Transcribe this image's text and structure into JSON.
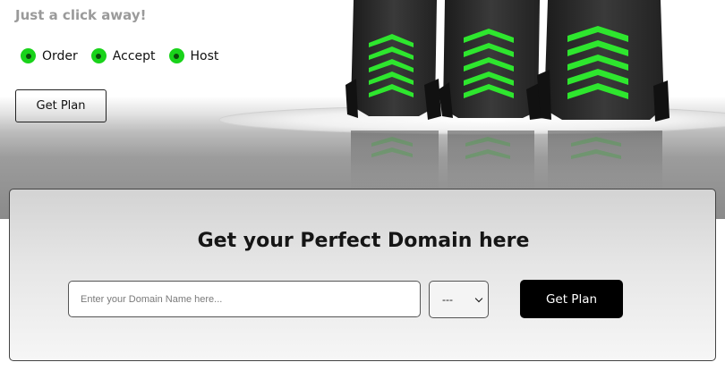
{
  "hero": {
    "tagline": "Just a click away!",
    "features": [
      {
        "label": "Order",
        "icon": "radio-checked-icon"
      },
      {
        "label": "Accept",
        "icon": "radio-checked-icon"
      },
      {
        "label": "Host",
        "icon": "radio-checked-icon"
      }
    ],
    "cta_label": "Get Plan",
    "accent_color": "#19d31a"
  },
  "domain_search": {
    "title": "Get your Perfect Domain here",
    "input_placeholder": "Enter your Domain Name here...",
    "input_value": "",
    "tld_selected": "---",
    "button_label": "Get Plan"
  }
}
